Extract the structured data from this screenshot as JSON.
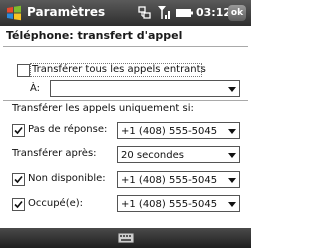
{
  "titlebar": {
    "app_title": "Paramètres",
    "clock": "03:12",
    "ok_label": "ok",
    "icons": [
      "windows-start-icon",
      "connectivity-icon",
      "signal-icon",
      "battery-icon"
    ]
  },
  "page_title": "Téléphone: transfert d'appel",
  "forward_all": {
    "label": "Transférer tous les appels entrants",
    "checked": false,
    "to_label": "À:",
    "to_value": ""
  },
  "conditional_heading": "Transférer les appels uniquement si:",
  "no_answer": {
    "label": "Pas de réponse:",
    "checked": true,
    "number": "+1 (408) 555-5045"
  },
  "forward_after": {
    "label": "Transférer après:",
    "value": "20 secondes"
  },
  "unavailable": {
    "label": "Non disponible:",
    "checked": true,
    "number": "+1 (408) 555-5045"
  },
  "busy": {
    "label": "Occupé(e):",
    "checked": true,
    "number": "+1 (408) 555-5045"
  },
  "bottombar": {
    "icon": "keyboard-icon"
  },
  "colors": {
    "titlebar": "#3a3a3a",
    "background": "#ffffff",
    "border": "#555555"
  }
}
